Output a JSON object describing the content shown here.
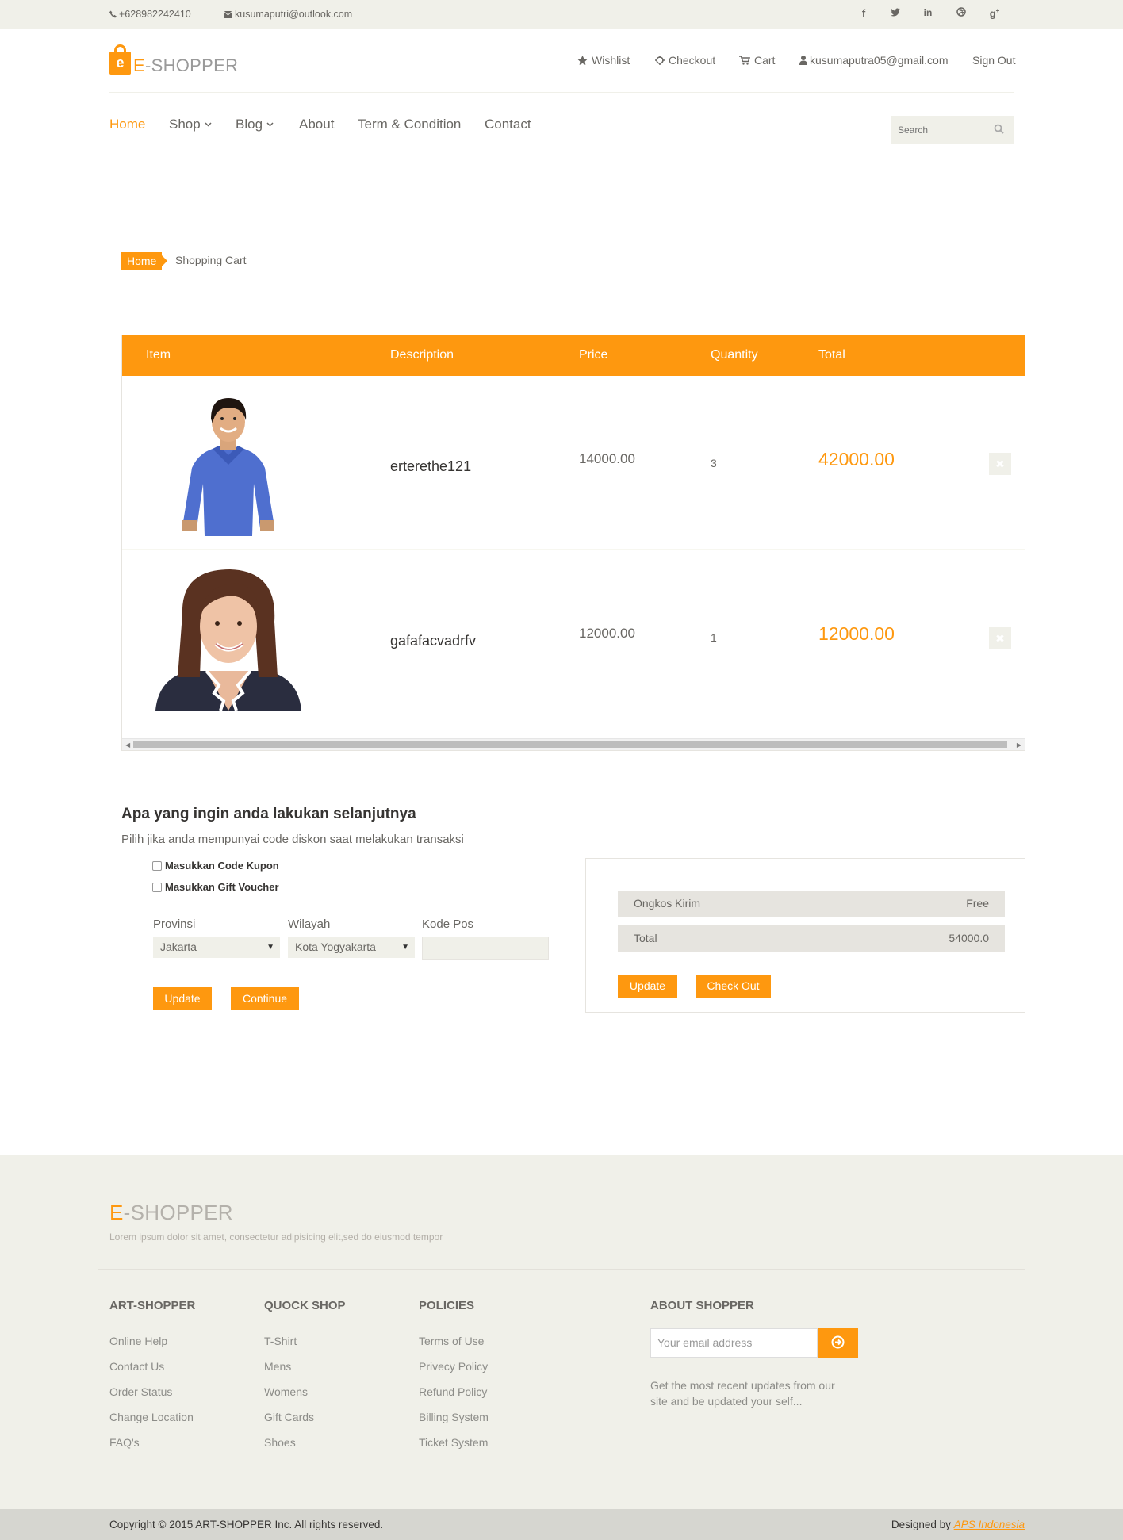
{
  "topbar": {
    "phone": "+628982242410",
    "email": "kusumaputri@outlook.com",
    "social": [
      "facebook-icon",
      "twitter-icon",
      "linkedin-icon",
      "dribbble-icon",
      "google-plus-icon"
    ]
  },
  "header": {
    "logo_e": "E",
    "logo_rest": "-SHOPPER",
    "wishlist": "Wishlist",
    "checkout": "Checkout",
    "cart": "Cart",
    "account": "kusumaputra05@gmail.com",
    "signout": "Sign Out"
  },
  "nav": {
    "home": "Home",
    "shop": "Shop",
    "blog": "Blog",
    "about": "About",
    "terms": "Term & Condition",
    "contact": "Contact",
    "search_placeholder": "Search"
  },
  "breadcrumb": {
    "home": "Home",
    "current": "Shopping Cart"
  },
  "cart": {
    "headers": {
      "item": "Item",
      "description": "Description",
      "price": "Price",
      "quantity": "Quantity",
      "total": "Total"
    },
    "rows": [
      {
        "name": "erterethe121",
        "price": "14000.00",
        "qty": "3",
        "total": "42000.00"
      },
      {
        "name": "gafafacvadrfv",
        "price": "12000.00",
        "qty": "1",
        "total": "12000.00"
      }
    ],
    "delete_glyph": "✖"
  },
  "next": {
    "title": "Apa yang ingin anda lakukan selanjutnya",
    "subtitle": "Pilih jika anda mempunyai code diskon saat melakukan transaksi",
    "coupon": "Masukkan Code Kupon",
    "voucher": "Masukkan Gift Voucher",
    "province_label": "Provinsi",
    "province_value": "Jakarta",
    "region_label": "Wilayah",
    "region_value": "Kota Yogyakarta",
    "postal_label": "Kode Pos",
    "update": "Update",
    "continue": "Continue"
  },
  "summary": {
    "shipping_label": "Ongkos Kirim",
    "shipping_value": "Free",
    "total_label": "Total",
    "total_value": "54000.0",
    "update": "Update",
    "checkout": "Check Out"
  },
  "footer": {
    "logo_e": "E",
    "logo_rest": "-SHOPPER",
    "tagline": "Lorem ipsum dolor sit amet, consectetur adipisicing elit,sed do eiusmod tempor",
    "col1": {
      "title": "ART-SHOPPER",
      "links": [
        "Online Help",
        "Contact Us",
        "Order Status",
        "Change Location",
        "FAQ's"
      ]
    },
    "col2": {
      "title": "QUOCK SHOP",
      "links": [
        "T-Shirt",
        "Mens",
        "Womens",
        "Gift Cards",
        "Shoes"
      ]
    },
    "col3": {
      "title": "POLICIES",
      "links": [
        "Terms of Use",
        "Privecy Policy",
        "Refund Policy",
        "Billing System",
        "Ticket System"
      ]
    },
    "about": {
      "title": "ABOUT SHOPPER",
      "email_placeholder": "Your email address",
      "note": "Get the most recent updates from our site and be updated your self..."
    },
    "copyright": "Copyright © 2015 ART-SHOPPER Inc. All rights reserved.",
    "designed_by": "Designed by",
    "designer": "APS Indonesia"
  },
  "colors": {
    "accent": "#fe980f",
    "topbar_bg": "#f0f0e9",
    "text": "#696763"
  }
}
